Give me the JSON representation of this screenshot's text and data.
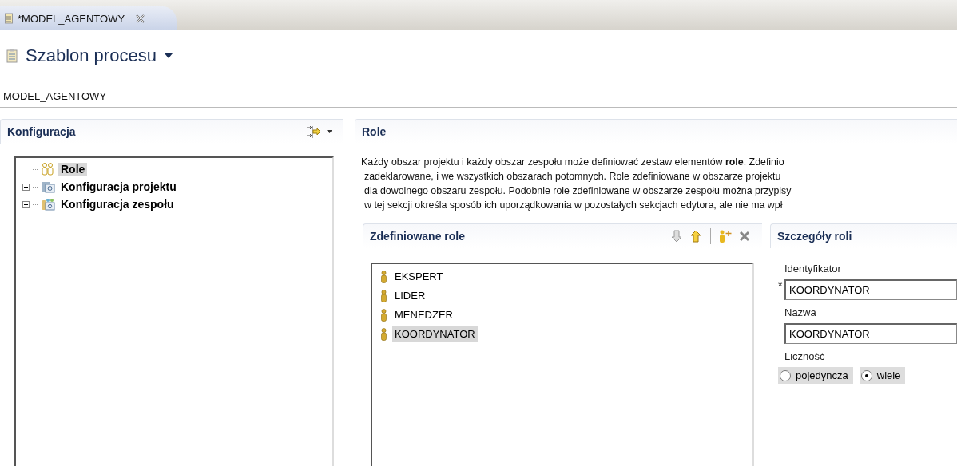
{
  "editor_tab": {
    "label": "*MODEL_AGENTOWY",
    "selected": true
  },
  "form": {
    "title": "Szablon procesu",
    "name": "MODEL_AGENTOWY"
  },
  "configuration": {
    "title": "Konfiguracja",
    "tree": [
      {
        "label": "Role",
        "kind": "roles",
        "selected": true,
        "expandable": false
      },
      {
        "label": "Konfiguracja projektu",
        "kind": "project",
        "selected": false,
        "expandable": true
      },
      {
        "label": "Konfiguracja zespołu",
        "kind": "team",
        "selected": false,
        "expandable": true
      }
    ]
  },
  "roles_section": {
    "title": "Role",
    "description": [
      "Każdy obszar projektu i każdy obszar zespołu może definiować zestaw elementów **role**. Zdefinio",
      "zadeklarowane, i we wszystkich obszarach potomnych. Role zdefiniowane w obszarze projektu",
      "dla dowolnego obszaru zespołu. Podobnie role zdefiniowane w obszarze zespołu można przypisy",
      "w tej sekcji określa sposób ich uporządkowania w pozostałych sekcjach edytora, ale nie ma wpł"
    ],
    "defined_roles": {
      "title": "Zdefiniowane role",
      "toolbar": [
        {
          "kind": "down",
          "disabled": true
        },
        {
          "kind": "up",
          "disabled": false
        },
        {
          "kind": "separator"
        },
        {
          "kind": "add",
          "disabled": false
        },
        {
          "kind": "remove",
          "disabled": false
        }
      ],
      "items": [
        {
          "label": "EKSPERT",
          "selected": false
        },
        {
          "label": "LIDER",
          "selected": false
        },
        {
          "label": "MENEDZER",
          "selected": false
        },
        {
          "label": "KOORDYNATOR",
          "selected": true
        }
      ]
    },
    "role_details": {
      "title": "Szczegóły roli",
      "fields": [
        {
          "label": "Identyfikator",
          "value": "KOORDYNATOR",
          "required": true
        },
        {
          "label": "Nazwa",
          "value": "KOORDYNATOR",
          "required": false
        }
      ],
      "required_mark": "*",
      "cardinality": {
        "label": "Liczność",
        "options": [
          {
            "label": "pojedyncza",
            "selected": false
          },
          {
            "label": "wiele",
            "selected": true
          }
        ]
      }
    }
  }
}
